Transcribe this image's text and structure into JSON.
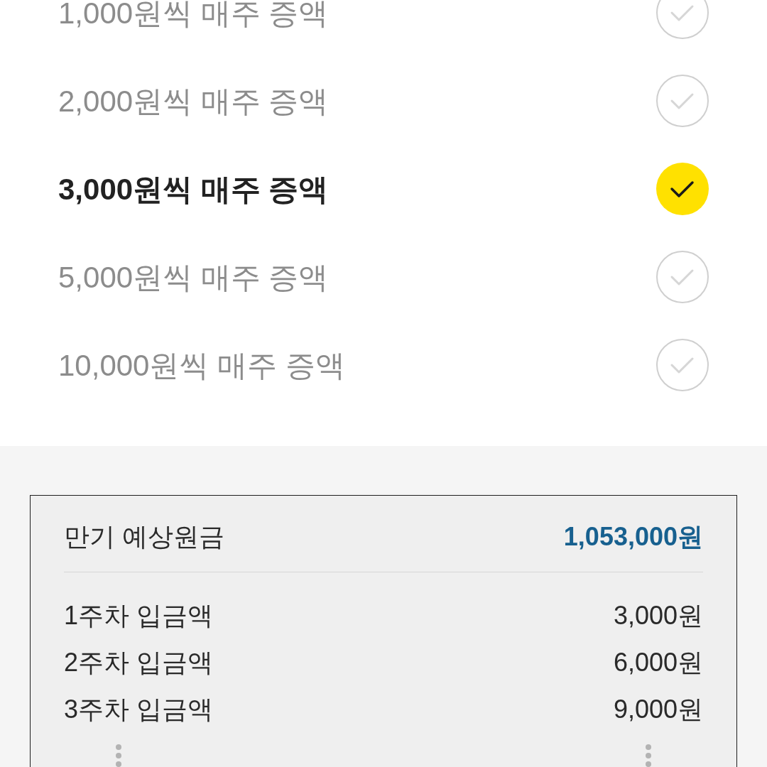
{
  "options": [
    {
      "label": "1,000원씩 매주 증액",
      "selected": false
    },
    {
      "label": "2,000원씩 매주 증액",
      "selected": false
    },
    {
      "label": "3,000원씩 매주 증액",
      "selected": true
    },
    {
      "label": "5,000원씩 매주 증액",
      "selected": false
    },
    {
      "label": "10,000원씩 매주 증액",
      "selected": false
    }
  ],
  "summary": {
    "title": "만기 예상원금",
    "total": "1,053,000원",
    "rows": [
      {
        "label": "1주차 입금액",
        "amount": "3,000원"
      },
      {
        "label": "2주차 입금액",
        "amount": "6,000원"
      },
      {
        "label": "3주차 입금액",
        "amount": "9,000원"
      }
    ],
    "more_rows": true
  }
}
